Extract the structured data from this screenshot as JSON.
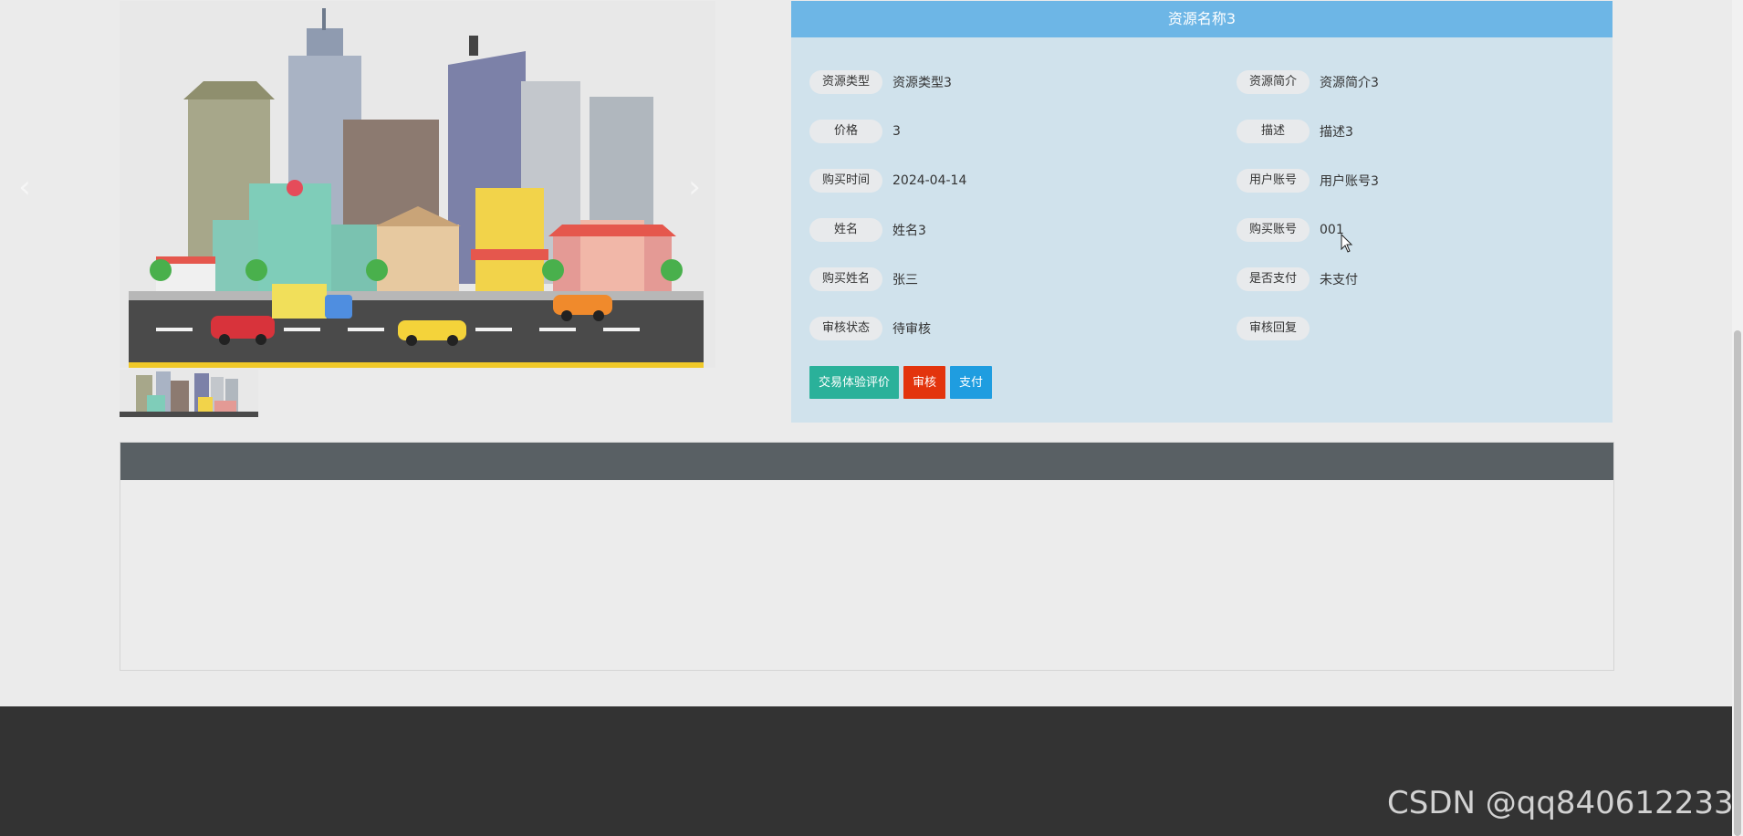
{
  "detail": {
    "title": "资源名称3",
    "fields": {
      "resource_type": {
        "label": "资源类型",
        "value": "资源类型3"
      },
      "resource_intro": {
        "label": "资源简介",
        "value": "资源简介3"
      },
      "price": {
        "label": "价格",
        "value": "3"
      },
      "description": {
        "label": "描述",
        "value": "描述3"
      },
      "purchase_time": {
        "label": "购买时间",
        "value": "2024-04-14"
      },
      "user_account": {
        "label": "用户账号",
        "value": "用户账号3"
      },
      "name": {
        "label": "姓名",
        "value": "姓名3"
      },
      "buyer_account": {
        "label": "购买账号",
        "value": "001"
      },
      "buyer_name": {
        "label": "购买姓名",
        "value": "张三"
      },
      "paid": {
        "label": "是否支付",
        "value": "未支付"
      },
      "review_status": {
        "label": "审核状态",
        "value": "待审核"
      },
      "review_reply": {
        "label": "审核回复",
        "value": ""
      }
    },
    "buttons": {
      "evaluate": "交易体验评价",
      "review": "审核",
      "pay": "支付"
    }
  },
  "gallery": {
    "prev_icon": "chevron-left-icon",
    "next_icon": "chevron-right-icon"
  },
  "watermark": "CSDN @qq840612233",
  "colors": {
    "title_bar": "#6db6e6",
    "panel_bg": "#d0e2ec",
    "btn_green": "#2ab19a",
    "btn_red": "#e3340d",
    "btn_blue": "#1f9de0",
    "section_header": "#596064",
    "footer": "#333333"
  }
}
